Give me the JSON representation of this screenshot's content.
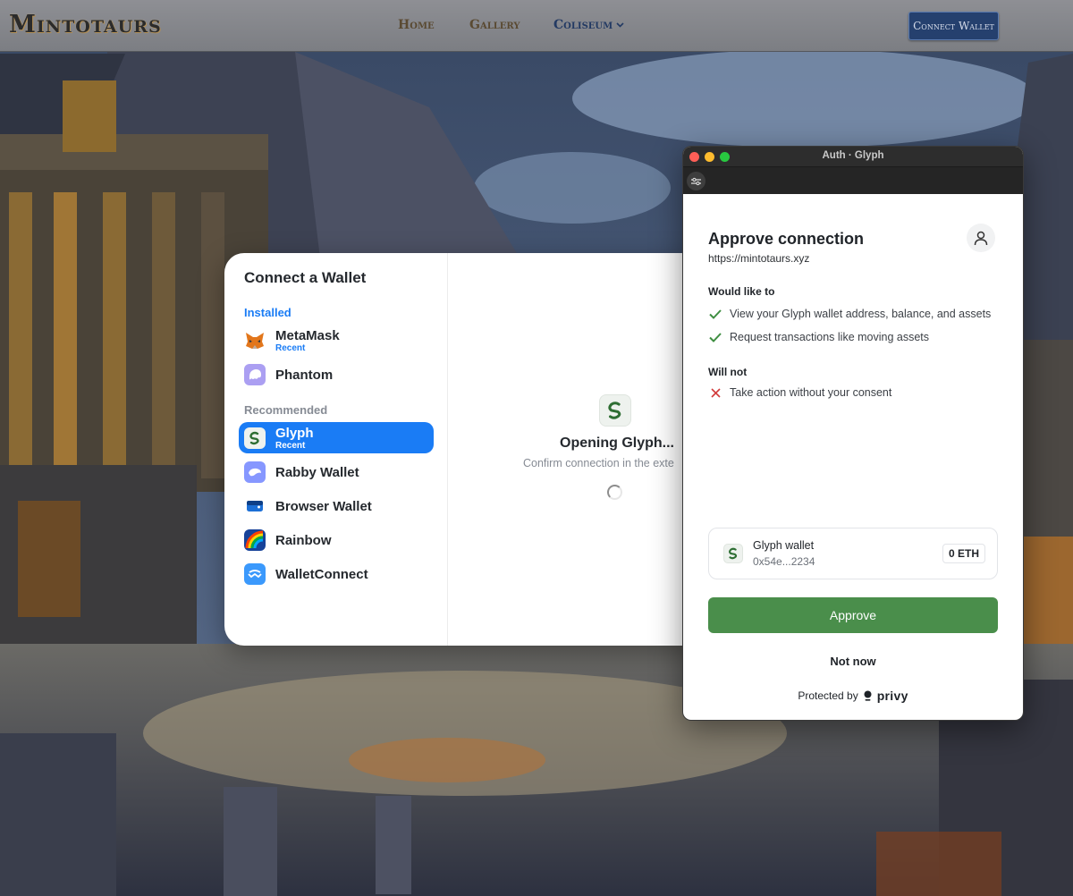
{
  "site": {
    "logo": "Mintotaurs",
    "nav": [
      {
        "label": "Home"
      },
      {
        "label": "Gallery"
      },
      {
        "label": "Coliseum"
      }
    ],
    "connect_wallet": "Connect Wallet"
  },
  "modal": {
    "title": "Connect a Wallet",
    "installed_label": "Installed",
    "recommended_label": "Recommended",
    "installed": [
      {
        "name": "MetaMask",
        "sub": "Recent",
        "icon": "metamask-fox-icon"
      },
      {
        "name": "Phantom",
        "sub": "",
        "icon": "phantom-ghost-icon"
      }
    ],
    "recommended": [
      {
        "name": "Glyph",
        "sub": "Recent",
        "icon": "glyph-icon",
        "selected": true
      },
      {
        "name": "Rabby Wallet",
        "sub": "",
        "icon": "rabby-icon"
      },
      {
        "name": "Browser Wallet",
        "sub": "",
        "icon": "browser-wallet-icon"
      },
      {
        "name": "Rainbow",
        "sub": "",
        "icon": "rainbow-icon"
      },
      {
        "name": "WalletConnect",
        "sub": "",
        "icon": "walletconnect-icon"
      }
    ],
    "opening": "Opening Glyph...",
    "confirm": "Confirm connection in the exte"
  },
  "auth": {
    "window_title": "Auth · Glyph",
    "title": "Approve connection",
    "url": "https://mintotaurs.xyz",
    "would_like_label": "Would like to",
    "would_like": [
      "View your Glyph wallet address, balance, and assets",
      "Request transactions like moving assets"
    ],
    "will_not_label": "Will not",
    "will_not": [
      "Take action without your consent"
    ],
    "wallet_name": "Glyph wallet",
    "wallet_address": "0x54e...2234",
    "balance": "0 ETH",
    "approve": "Approve",
    "not_now": "Not now",
    "protected_by": "Protected by",
    "brand": "privy"
  },
  "colors": {
    "accent_blue": "#1a7cf5",
    "approve_green": "#4a8e4b",
    "check_green": "#3e8e41",
    "cross_red": "#d23b3b"
  }
}
